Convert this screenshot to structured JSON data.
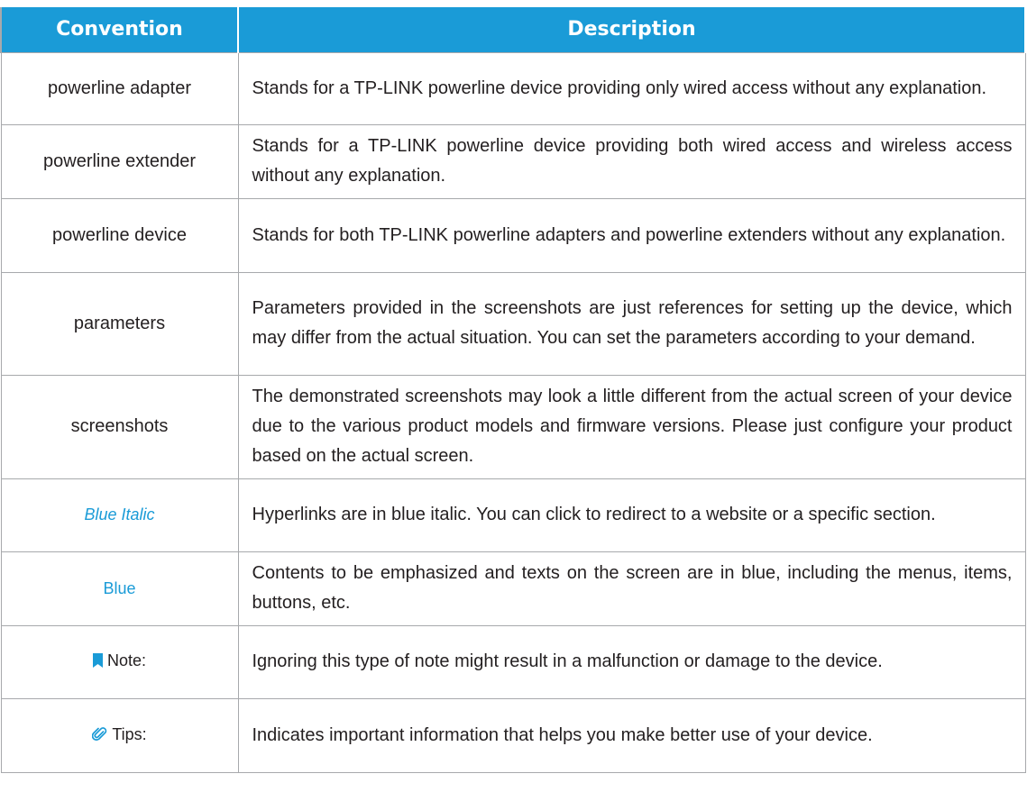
{
  "header": {
    "convention": "Convention",
    "description": "Description"
  },
  "rows": [
    {
      "convention": "powerline adapter",
      "description": "Stands for a TP-LINK powerline device providing only wired access without any explanation."
    },
    {
      "convention": "powerline extender",
      "description": "Stands for a TP-LINK powerline device providing both wired access and wireless access without any explanation."
    },
    {
      "convention": "powerline device",
      "description": "Stands for both TP-LINK powerline adapters and powerline extenders without any explanation."
    },
    {
      "convention": "parameters",
      "description": "Parameters provided in the screenshots are just references for setting up the device, which may differ from the actual situation. You can set the parameters according to your demand."
    },
    {
      "convention": "screenshots",
      "description": "The demonstrated screenshots may look a little different from the actual screen of your device due to the various product models and firmware versions. Please just configure your product based on the actual screen."
    },
    {
      "convention": "Blue Italic",
      "description": "Hyperlinks are in blue italic. You can click to redirect to a website or a specific section."
    },
    {
      "convention": "Blue",
      "description": "Contents to be emphasized and texts on the screen are in blue, including the menus, items, buttons, etc."
    },
    {
      "convention": "Note:",
      "icon": "bookmark-icon",
      "description": "Ignoring this type of note might result in a malfunction or damage to the device."
    },
    {
      "convention": "Tips:",
      "icon": "paperclip-icon",
      "description": "Indicates important information that helps you make better use of your device."
    }
  ],
  "colors": {
    "header_bg": "#1a9bd7",
    "header_text": "#ffffff",
    "link_blue": "#1a9bd7",
    "border": "#a7a9ac",
    "body_text": "#231f20"
  }
}
